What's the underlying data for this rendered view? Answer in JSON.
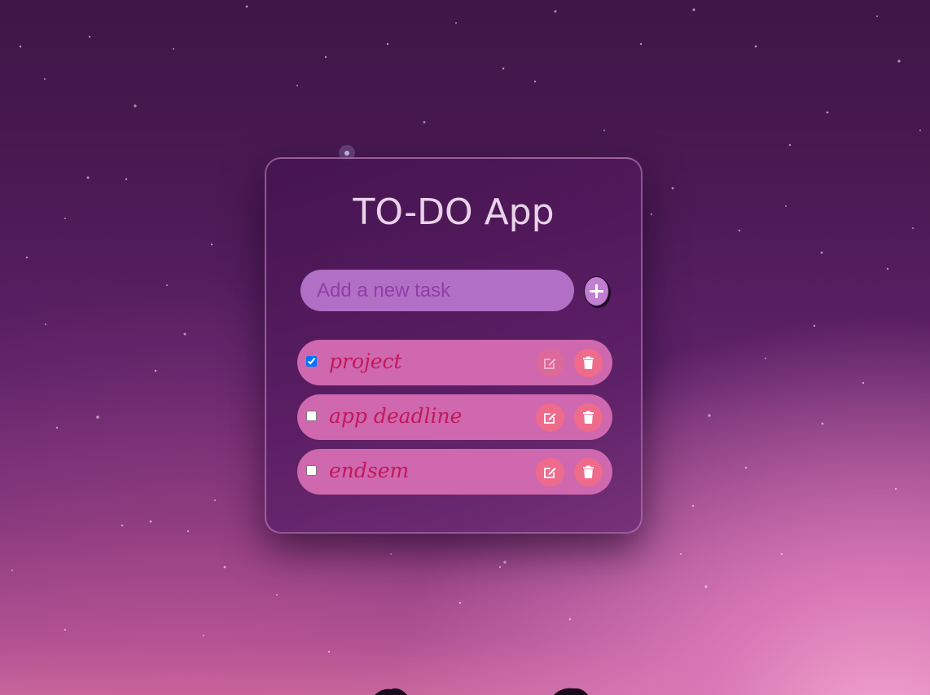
{
  "app": {
    "title": "TO-DO App"
  },
  "input": {
    "placeholder": "Add a new task",
    "value": ""
  },
  "add_button": {
    "icon": "plus-icon"
  },
  "tasks": [
    {
      "text": "project",
      "completed": true
    },
    {
      "text": "app deadline",
      "completed": false
    },
    {
      "text": "endsem",
      "completed": false
    }
  ],
  "task_actions": {
    "edit_icon": "edit-icon",
    "delete_icon": "trash-icon"
  },
  "colors": {
    "card_bg": "#4a1552",
    "input_bg": "#b26fc6",
    "task_bg": "#cf68ae",
    "task_text": "#c2185b",
    "action_button": "#ef6b8c",
    "title_text": "#ead2ea"
  }
}
